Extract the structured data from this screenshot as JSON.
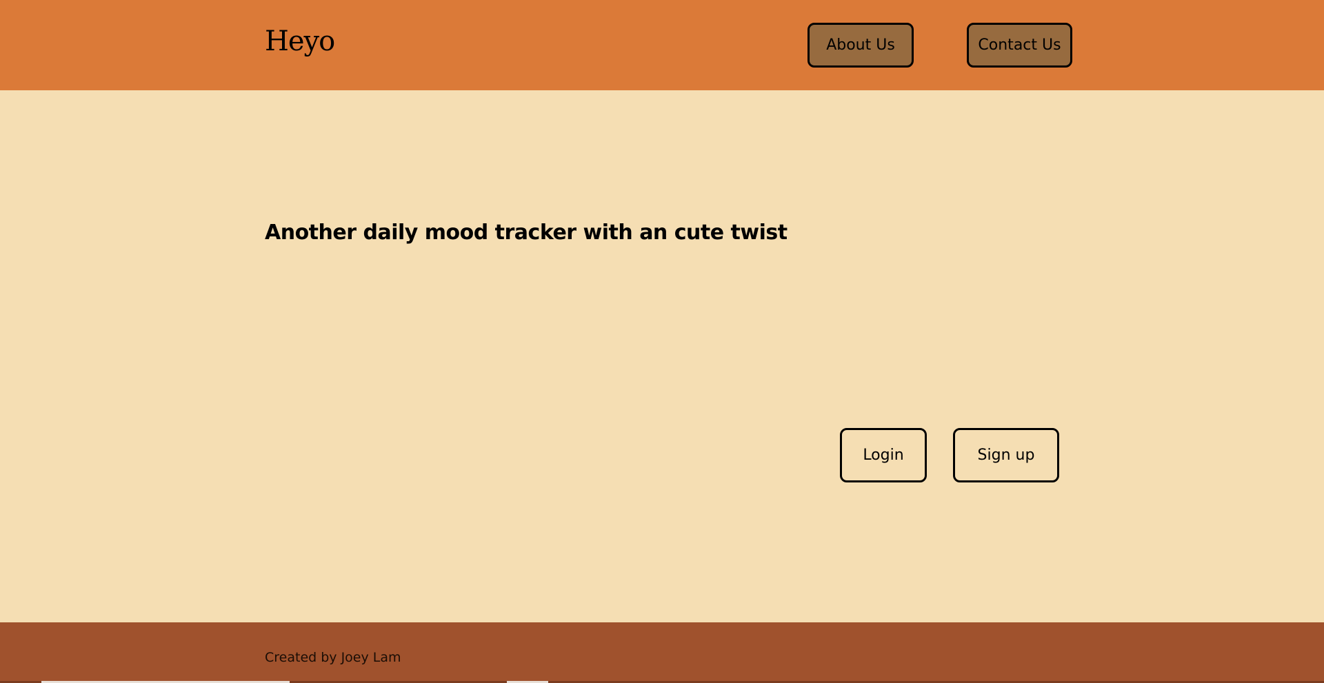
{
  "header": {
    "brand": "Heyo",
    "nav": {
      "about_label": "About Us",
      "contact_label": "Contact Us"
    }
  },
  "main": {
    "tagline": "Another daily mood tracker with an cute twist",
    "login_label": "Login",
    "signup_label": "Sign up"
  },
  "footer": {
    "credit": "Created by Joey Lam"
  },
  "colors": {
    "header_bg": "#db7a38",
    "nav_button_bg": "#976b3f",
    "page_bg": "#f5deb3",
    "footer_bg": "#a0522d",
    "text": "#000000"
  }
}
